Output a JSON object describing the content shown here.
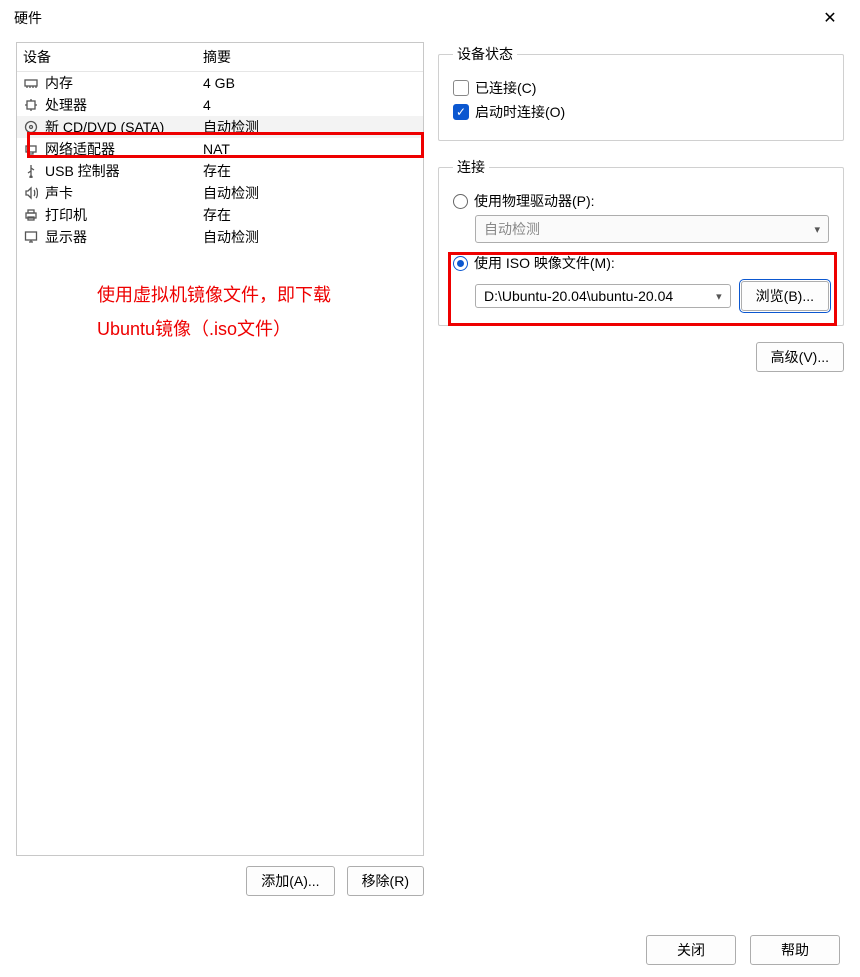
{
  "title": "硬件",
  "headers": {
    "device": "设备",
    "summary": "摘要"
  },
  "devices": [
    {
      "icon": "memory",
      "label": "内存",
      "summary": "4 GB",
      "selected": false
    },
    {
      "icon": "cpu",
      "label": "处理器",
      "summary": "4",
      "selected": false
    },
    {
      "icon": "disc",
      "label": "新 CD/DVD (SATA)",
      "summary": "自动检测",
      "selected": true
    },
    {
      "icon": "net",
      "label": "网络适配器",
      "summary": "NAT",
      "selected": false
    },
    {
      "icon": "usb",
      "label": "USB 控制器",
      "summary": "存在",
      "selected": false
    },
    {
      "icon": "sound",
      "label": "声卡",
      "summary": "自动检测",
      "selected": false
    },
    {
      "icon": "printer",
      "label": "打印机",
      "summary": "存在",
      "selected": false
    },
    {
      "icon": "display",
      "label": "显示器",
      "summary": "自动检测",
      "selected": false
    }
  ],
  "annotation": {
    "line1": "使用虚拟机镜像文件，即下载",
    "line2": "Ubuntu镜像（.iso文件）"
  },
  "buttons": {
    "add": "添加(A)...",
    "remove": "移除(R)",
    "advanced": "高级(V)...",
    "browse": "浏览(B)...",
    "close": "关闭",
    "help": "帮助"
  },
  "status": {
    "legend": "设备状态",
    "connected": "已连接(C)",
    "connect_on_power": "启动时连接(O)"
  },
  "connection": {
    "legend": "连接",
    "physical": "使用物理驱动器(P):",
    "auto_detect": "自动检测",
    "iso": "使用 ISO 映像文件(M):",
    "iso_path": "D:\\Ubuntu-20.04\\ubuntu-20.04"
  }
}
